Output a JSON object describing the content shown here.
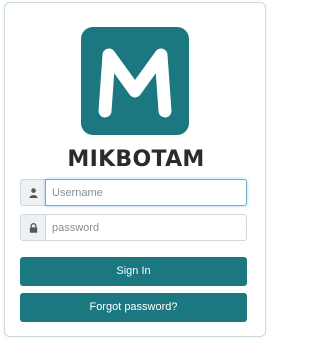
{
  "brand": {
    "logo_letter": "M",
    "name": "MIKBOTAM",
    "color": "#1b7780"
  },
  "form": {
    "username": {
      "icon": "user-icon",
      "placeholder": "Username",
      "value": ""
    },
    "password": {
      "icon": "lock-icon",
      "placeholder": "password",
      "value": ""
    },
    "signin_label": "Sign In",
    "forgot_label": "Forgot password?"
  }
}
